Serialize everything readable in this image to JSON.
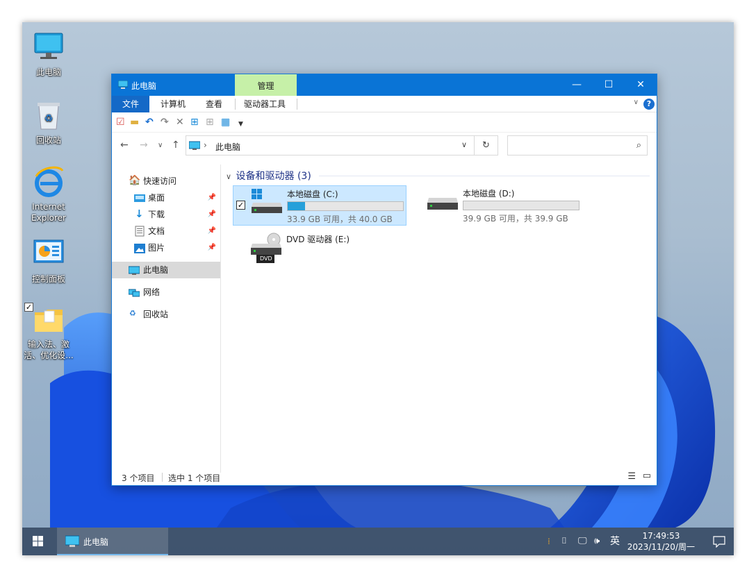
{
  "desktop": {
    "icons": [
      {
        "label": "此电脑",
        "icon": "computer-icon"
      },
      {
        "label": "回收站",
        "icon": "recycle-bin-icon"
      },
      {
        "label_lines": [
          "Internet",
          "Explorer"
        ],
        "icon": "internet-explorer-icon"
      },
      {
        "label": "控制面板",
        "icon": "control-panel-icon"
      },
      {
        "label_lines": [
          "输入法、激",
          "活、优化设..."
        ],
        "icon": "folder-icon"
      }
    ]
  },
  "window": {
    "title": "此电脑",
    "context_tab": "管理",
    "menu_tabs": [
      "文件",
      "计算机",
      "查看",
      "驱动器工具"
    ],
    "help_label": "?",
    "address": {
      "location": "此电脑"
    },
    "search": {
      "placeholder": "",
      "value": ""
    },
    "nav_pane": {
      "quick_access": "快速访问",
      "pinned": [
        "桌面",
        "下载",
        "文档",
        "图片"
      ],
      "this_pc": "此电脑",
      "network": "网络",
      "recycle_bin": "回收站"
    },
    "group": {
      "title": "设备和驱动器 (3)",
      "drives": [
        {
          "name": "本地磁盘 (C:)",
          "free_text": "33.9 GB 可用，共 40.0 GB",
          "used_fraction": 0.15,
          "selected": true
        },
        {
          "name": "本地磁盘 (D:)",
          "free_text": "39.9 GB 可用，共 39.9 GB",
          "used_fraction": 0.0,
          "selected": false
        },
        {
          "name": "DVD 驱动器 (E:)",
          "icon_label": "DVD"
        }
      ]
    },
    "status": {
      "items_count": "3 个项目",
      "selected_count": "选中 1 个项目"
    }
  },
  "taskbar": {
    "app_label": "此电脑",
    "ime": "英",
    "time": "17:49:53",
    "date": "2023/11/20/周一"
  }
}
